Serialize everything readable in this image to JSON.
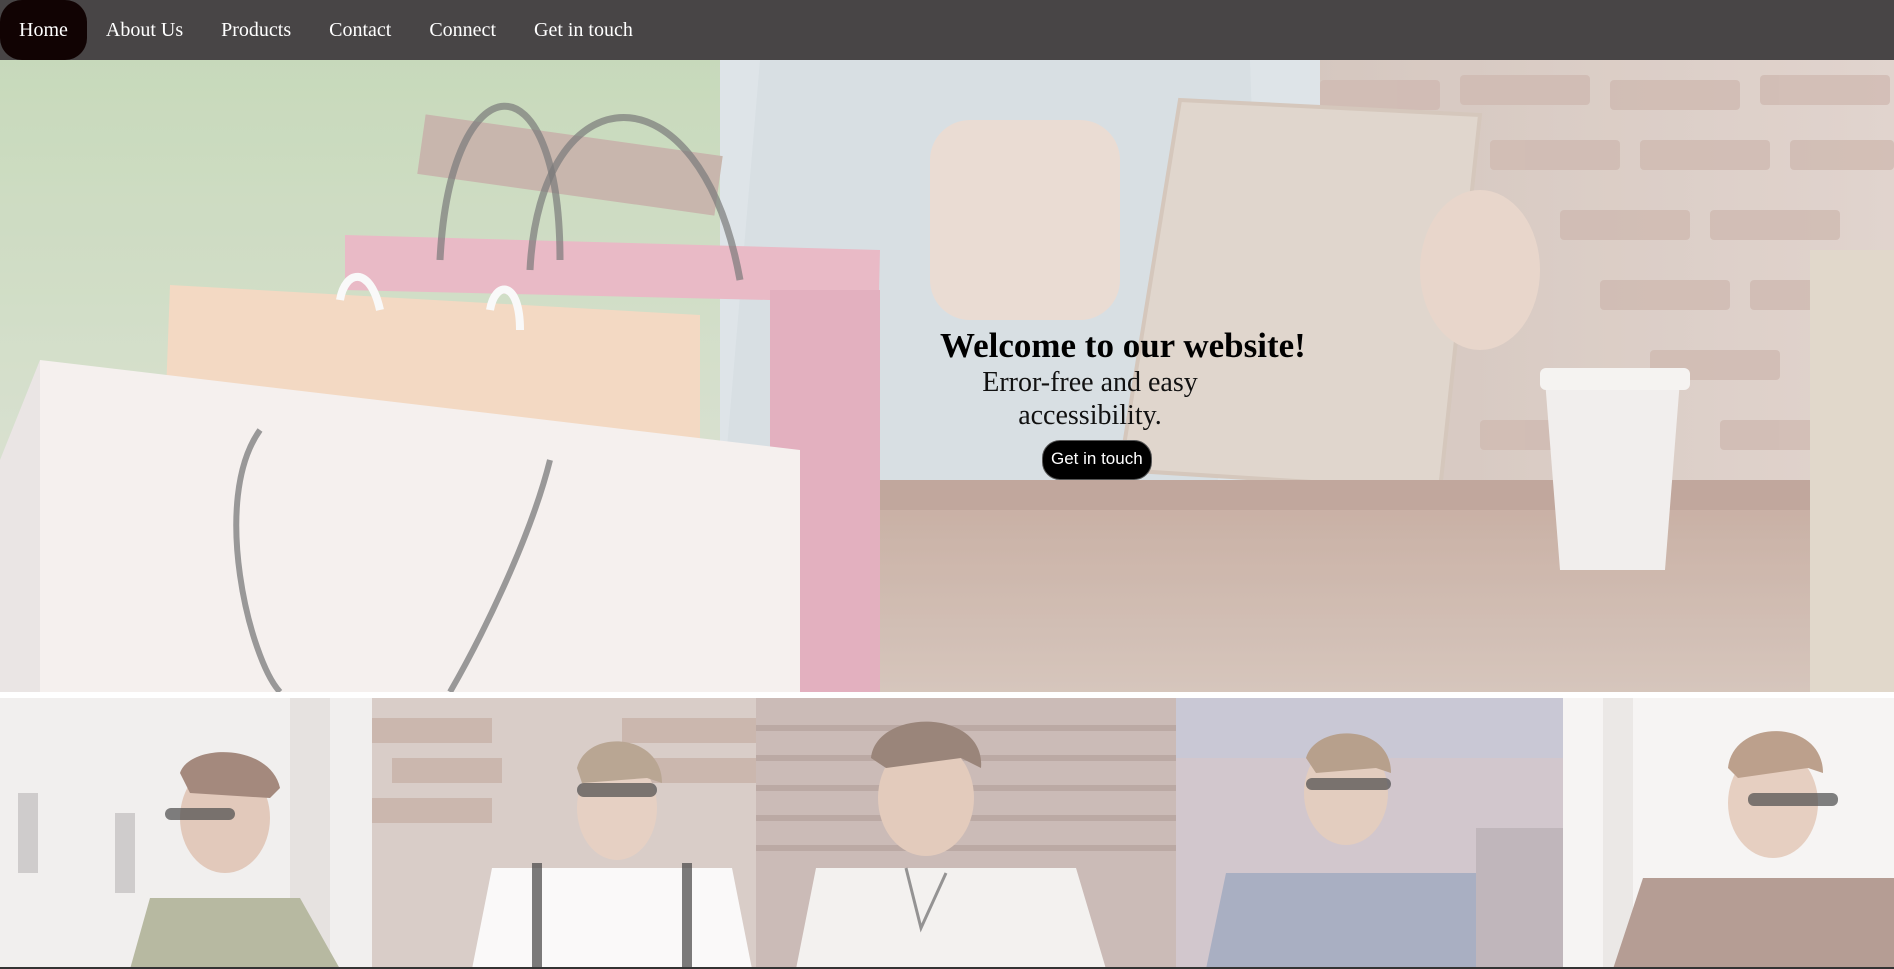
{
  "nav": {
    "items": [
      {
        "label": "Home",
        "active": true
      },
      {
        "label": "About Us"
      },
      {
        "label": "Products"
      },
      {
        "label": "Contact"
      },
      {
        "label": "Connect"
      },
      {
        "label": "Get in touch"
      }
    ]
  },
  "hero": {
    "title": "Welcome to our website!",
    "subtitle": "Error-free and easy accessibility.",
    "button_label": "Get in touch"
  },
  "colors": {
    "navbar_bg": "#484546",
    "nav_active_bg": "#110303",
    "button_bg": "#000000"
  }
}
